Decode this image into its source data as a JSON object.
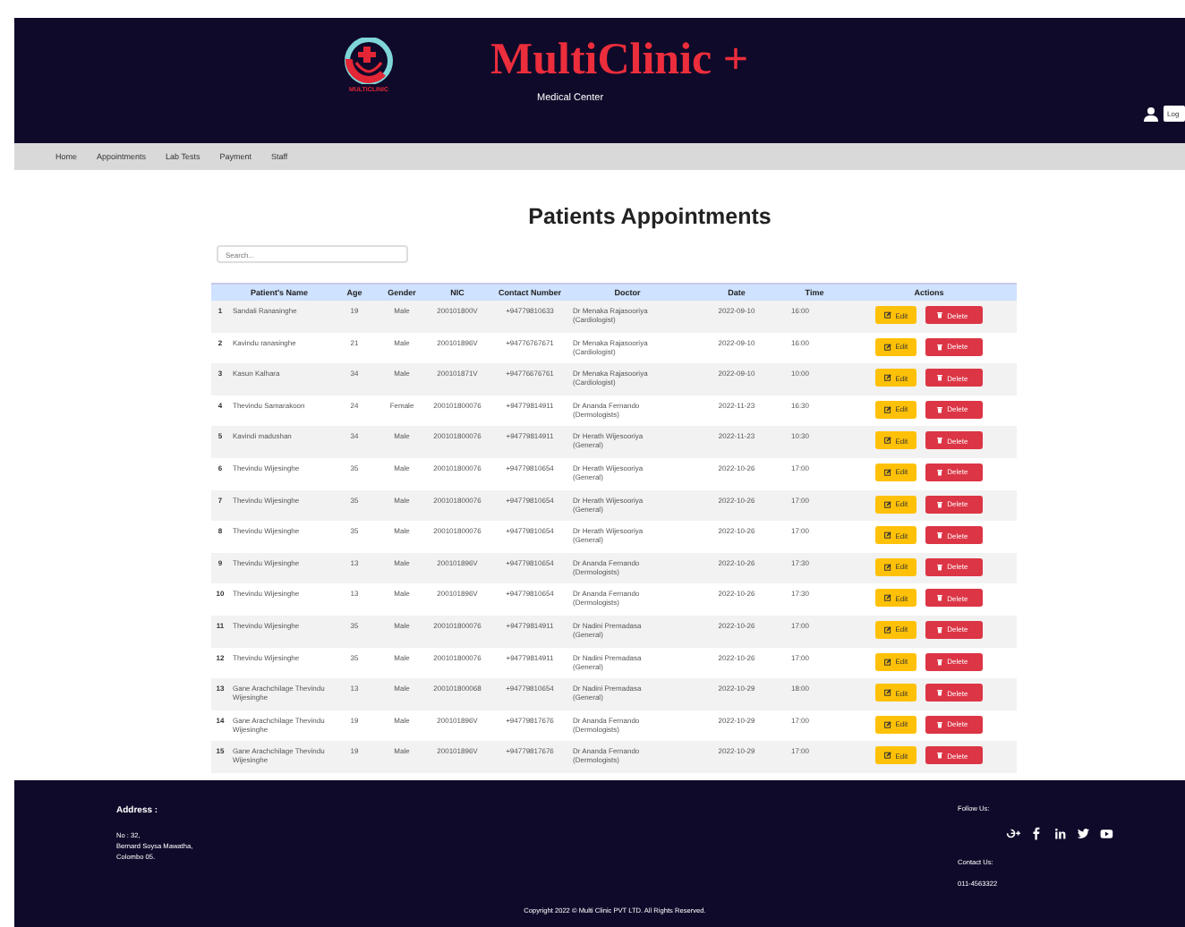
{
  "header": {
    "logo_text": "MULTICLINIC",
    "title": "MultiClinic +",
    "subtitle": "Medical Center",
    "login_button": "Log"
  },
  "nav": [
    "Home",
    "Appointments",
    "Lab Tests",
    "Payment",
    "Staff"
  ],
  "page_title": "Patients Appointments",
  "search": {
    "placeholder": "Search..."
  },
  "table": {
    "columns": [
      "",
      "Patient's Name",
      "Age",
      "Gender",
      "NIC",
      "Contact Number",
      "Doctor",
      "Date",
      "Time",
      "Actions"
    ],
    "rows": [
      {
        "no": "1",
        "name": "Sandali Ranasinghe",
        "age": "19",
        "gender": "Male",
        "nic": "200101800V",
        "contact": "+94779810633",
        "doctor": "Dr Menaka Rajasooriya",
        "specialty": "(Cardiologist)",
        "date": "2022-09-10",
        "time": "16:00",
        "edit": "Edit",
        "delete": "Delete"
      },
      {
        "no": "2",
        "name": "Kavindu ranasinghe",
        "age": "21",
        "gender": "Male",
        "nic": "200101896V",
        "contact": "+94776767671",
        "doctor": "Dr Menaka Rajasooriya",
        "specialty": "(Cardiologist)",
        "date": "2022-09-10",
        "time": "16:00",
        "edit": "Edit",
        "delete": "Delete"
      },
      {
        "no": "3",
        "name": "Kasun Kalhara",
        "age": "34",
        "gender": "Male",
        "nic": "200101871V",
        "contact": "+94776676761",
        "doctor": "Dr Menaka Rajasooriya",
        "specialty": "(Cardiologist)",
        "date": "2022-09-10",
        "time": "10:00",
        "edit": "Edit",
        "delete": "Delete"
      },
      {
        "no": "4",
        "name": "Thevindu Samarakoon",
        "age": "24",
        "gender": "Female",
        "nic": "200101800076",
        "contact": "+94779814911",
        "doctor": "Dr Ananda Fernando",
        "specialty": "(Dermologists)",
        "date": "2022-11-23",
        "time": "16:30",
        "edit": "Edit",
        "delete": "Delete"
      },
      {
        "no": "5",
        "name": "Kavindi madushan",
        "age": "34",
        "gender": "Male",
        "nic": "200101800076",
        "contact": "+94779814911",
        "doctor": "Dr Herath Wijesooriya",
        "specialty": "(General)",
        "date": "2022-11-23",
        "time": "10:30",
        "edit": "Edit",
        "delete": "Delete"
      },
      {
        "no": "6",
        "name": "Thevindu Wijesinghe",
        "age": "35",
        "gender": "Male",
        "nic": "200101800076",
        "contact": "+94779810654",
        "doctor": "Dr Herath Wijesooriya",
        "specialty": "(General)",
        "date": "2022-10-26",
        "time": "17:00",
        "edit": "Edit",
        "delete": "Delete"
      },
      {
        "no": "7",
        "name": "Thevindu Wijesinghe",
        "age": "35",
        "gender": "Male",
        "nic": "200101800076",
        "contact": "+94779810654",
        "doctor": "Dr Herath Wijesooriya",
        "specialty": "(General)",
        "date": "2022-10-26",
        "time": "17:00",
        "edit": "Edit",
        "delete": "Delete"
      },
      {
        "no": "8",
        "name": "Thevindu Wijesinghe",
        "age": "35",
        "gender": "Male",
        "nic": "200101800076",
        "contact": "+94779810654",
        "doctor": "Dr Herath Wijesooriya",
        "specialty": "(General)",
        "date": "2022-10-26",
        "time": "17:00",
        "edit": "Edit",
        "delete": "Delete"
      },
      {
        "no": "9",
        "name": "Thevindu Wijesinghe",
        "age": "13",
        "gender": "Male",
        "nic": "200101896V",
        "contact": "+94779810654",
        "doctor": "Dr Ananda Fernando",
        "specialty": "(Dermologists)",
        "date": "2022-10-26",
        "time": "17:30",
        "edit": "Edit",
        "delete": "Delete"
      },
      {
        "no": "10",
        "name": "Thevindu Wijesinghe",
        "age": "13",
        "gender": "Male",
        "nic": "200101896V",
        "contact": "+94779810654",
        "doctor": "Dr Ananda Fernando",
        "specialty": "(Dermologists)",
        "date": "2022-10-26",
        "time": "17:30",
        "edit": "Edit",
        "delete": "Delete"
      },
      {
        "no": "11",
        "name": "Thevindu Wijesinghe",
        "age": "35",
        "gender": "Male",
        "nic": "200101800076",
        "contact": "+94779814911",
        "doctor": "Dr Nadini Premadasa",
        "specialty": "(General)",
        "date": "2022-10-26",
        "time": "17:00",
        "edit": "Edit",
        "delete": "Delete"
      },
      {
        "no": "12",
        "name": "Thevindu Wijesinghe",
        "age": "35",
        "gender": "Male",
        "nic": "200101800076",
        "contact": "+94779814911",
        "doctor": "Dr Nadini Premadasa",
        "specialty": "(General)",
        "date": "2022-10-26",
        "time": "17:00",
        "edit": "Edit",
        "delete": "Delete"
      },
      {
        "no": "13",
        "name": "Gane Arachchilage Thevindu Wijesinghe",
        "age": "13",
        "gender": "Male",
        "nic": "200101800068",
        "contact": "+94779810654",
        "doctor": "Dr Nadini Premadasa",
        "specialty": "(General)",
        "date": "2022-10-29",
        "time": "18:00",
        "edit": "Edit",
        "delete": "Delete"
      },
      {
        "no": "14",
        "name": "Gane Arachchilage Thevindu Wijesinghe",
        "age": "19",
        "gender": "Male",
        "nic": "200101896V",
        "contact": "+94779817676",
        "doctor": "Dr Ananda Fernando",
        "specialty": "(Dermologists)",
        "date": "2022-10-29",
        "time": "17:00",
        "edit": "Edit",
        "delete": "Delete"
      },
      {
        "no": "15",
        "name": "Gane Arachchilage Thevindu Wijesinghe",
        "age": "19",
        "gender": "Male",
        "nic": "200101896V",
        "contact": "+94779817676",
        "doctor": "Dr Ananda Fernando",
        "specialty": "(Dermologists)",
        "date": "2022-10-29",
        "time": "17:00",
        "edit": "Edit",
        "delete": "Delete"
      }
    ]
  },
  "footer": {
    "address_heading": "Address :",
    "address_lines": [
      "No : 32,",
      "Bernard Soysa Mawatha,",
      "Colombo 05."
    ],
    "follow_heading": "Follow Us:",
    "social": [
      {
        "kind": "googleplus"
      },
      {
        "kind": "facebook"
      },
      {
        "kind": "linkedin"
      },
      {
        "kind": "twitter"
      },
      {
        "kind": "youtube"
      }
    ],
    "contact_heading": "Contact Us:",
    "phone": "011-4563322",
    "copyright": "Copyright 2022 © Multi Clinic PVT LTD. All Rights Reserved."
  }
}
